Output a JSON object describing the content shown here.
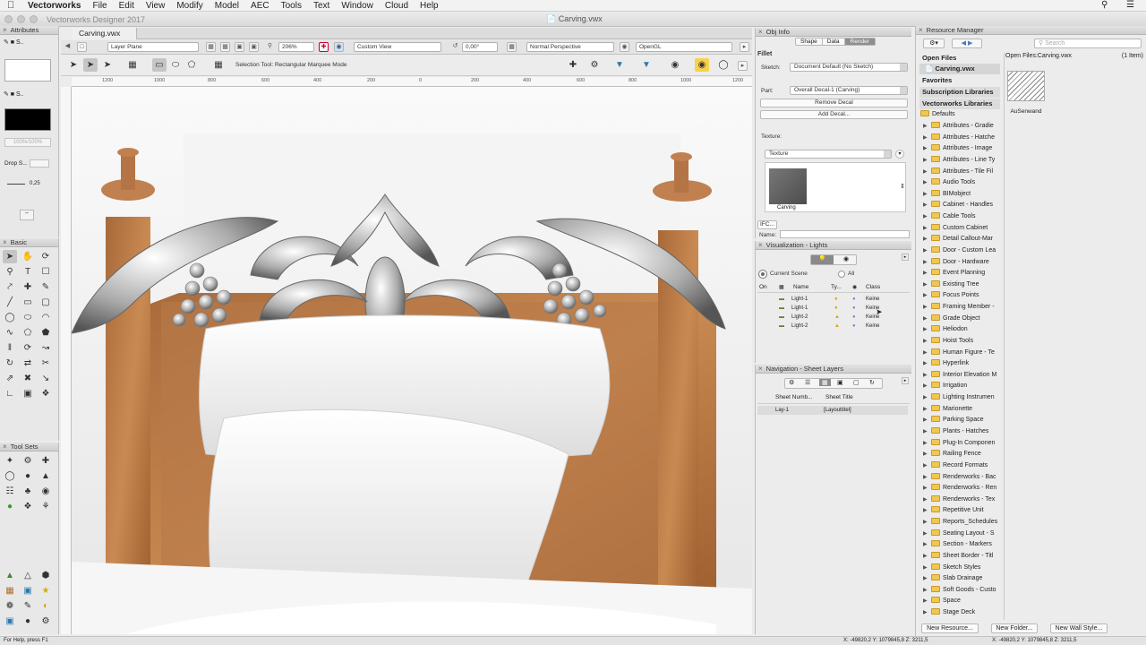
{
  "menubar": {
    "app": "Vectorworks",
    "items": [
      "File",
      "Edit",
      "View",
      "Modify",
      "Model",
      "AEC",
      "Tools",
      "Text",
      "Window",
      "Cloud",
      "Help"
    ]
  },
  "window": {
    "app_title": "Vectorworks Designer 2017",
    "doc_title": "Carving.vwx"
  },
  "doc_tab": "Carving.vwx",
  "view_bar": {
    "plane": "Layer Plane",
    "zoom": "206%",
    "view": "Custom View",
    "angle": "0,00°",
    "projection": "Normal Perspective",
    "render": "OpenGL"
  },
  "mode_bar": {
    "mode_text": "Selection Tool: Rectangular Marquee Mode"
  },
  "ruler": {
    "labels": [
      "1200",
      "1000",
      "800",
      "600",
      "400",
      "200",
      "0",
      "200",
      "400",
      "600",
      "800",
      "1000",
      "1200"
    ]
  },
  "attributes": {
    "title": "Attributes",
    "opacity": "100%/100%",
    "drop_shadow": "Drop S...",
    "line_weight": "0,25"
  },
  "basic": {
    "title": "Basic"
  },
  "toolsets": {
    "title": "Tool Sets"
  },
  "status": {
    "help": "For Help, press F1",
    "coords": "X: -49820,2   Y: 1079845,8   Z: 3211,5",
    "coords2": "X: -49820,2   Y: 1079845,8   Z: 3211,5"
  },
  "obj_info": {
    "title": "Obj Info",
    "tabs": [
      "Shape",
      "Data",
      "Render"
    ],
    "active_tab": "Render",
    "object_type": "Fillet",
    "sketch_label": "Sketch:",
    "sketch_value": "Document Default (No Sketch)",
    "part_label": "Part:",
    "part_value": "Overall Decal-1 (Carving)",
    "remove_decal": "Remove Decal",
    "add_decal": "Add Decal...",
    "texture_label": "Texture:",
    "texture_value": "Texture",
    "texture_name": "Carving",
    "ifc_label": "IFC...",
    "name_label": "Name:"
  },
  "viz_lights": {
    "title": "Visualization - Lights",
    "current_scene": "Current Scene",
    "all": "All",
    "columns": [
      "On",
      "Name",
      "Ty...",
      "Class"
    ],
    "rows": [
      {
        "name": "Light-1",
        "class": "Keine"
      },
      {
        "name": "Light-1",
        "class": "Keine"
      },
      {
        "name": "Light-2",
        "class": "Keine"
      },
      {
        "name": "Light-2",
        "class": "Keine"
      }
    ]
  },
  "nav_sheets": {
    "title": "Navigation - Sheet Layers",
    "columns": [
      "Sheet Numb...",
      "Sheet Title"
    ],
    "rows": [
      {
        "num": "Lay-1",
        "title": "[Layouttitel]"
      }
    ]
  },
  "resource_manager": {
    "title": "Resource Manager",
    "search_placeholder": "Search",
    "sections": [
      "Open Files",
      "Carving.vwx",
      "Favorites",
      "Subscription Libraries",
      "Vectorworks Libraries"
    ],
    "defaults": "Defaults",
    "path": "Open Files:Carving.vwx",
    "count": "(1 Item)",
    "item_name": "AuSenwand",
    "folders": [
      "Attributes - Gradie",
      "Attributes - Hatche",
      "Attributes - Image",
      "Attributes - Line Ty",
      "Attributes - Tile Fil",
      "Audio Tools",
      "BIMobject",
      "Cabinet - Handles",
      "Cable Tools",
      "Custom Cabinet",
      "Detail Callout-Mar",
      "Door - Custom Lea",
      "Door - Hardware",
      "Event Planning",
      "Existing Tree",
      "Focus Points",
      "Framing Member -",
      "Grade Object",
      "Heliodon",
      "Hoist Tools",
      "Human Figure - Te",
      "Hyperlink",
      "Interior Elevation M",
      "Irrigation",
      "Lighting Instrumen",
      "Marionette",
      "Parking Space",
      "Plants - Hatches",
      "Plug-In Componen",
      "Railing Fence",
      "Record Formats",
      "Renderworks - Bac",
      "Renderworks - Ren",
      "Renderworks - Tex",
      "Repetitive Unit",
      "Reports_Schedules",
      "Seating Layout - S",
      "Section - Markers",
      "Sheet Border - Titl",
      "Sketch Styles",
      "Slab Drainage",
      "Soft Goods - Custo",
      "Space",
      "Stage Deck"
    ],
    "buttons": [
      "New Resource...",
      "New Folder...",
      "New Wall Style..."
    ]
  }
}
